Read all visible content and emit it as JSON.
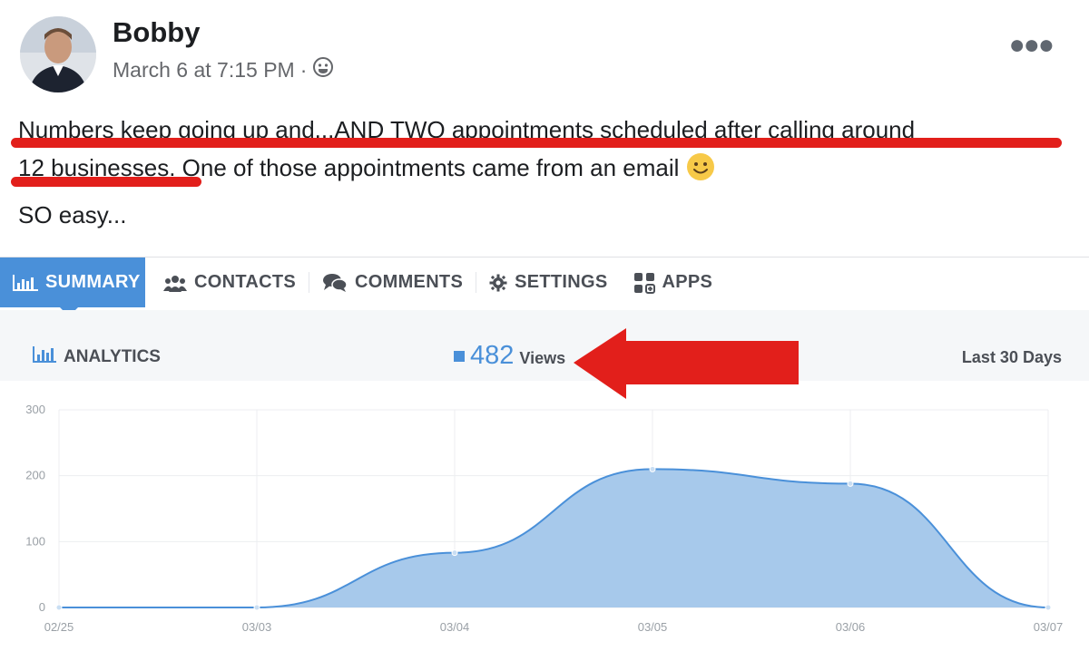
{
  "post": {
    "author": "Bobby",
    "timestamp": "March 6 at 7:15 PM",
    "separator": "·",
    "audience_icon": "friends-icon",
    "more_icon": "ellipsis-icon",
    "line1": "Numbers keep going up and...AND TWO appointments scheduled after calling around",
    "line2_start": "12 businesses.",
    "line2_end": " One of those appointments came from an email ",
    "line3": "SO easy..."
  },
  "tabs": [
    {
      "label": "SUMMARY",
      "icon": "bar-chart-icon",
      "active": true
    },
    {
      "label": "CONTACTS",
      "icon": "people-icon",
      "active": false
    },
    {
      "label": "COMMENTS",
      "icon": "comments-icon",
      "active": false
    },
    {
      "label": "SETTINGS",
      "icon": "gear-icon",
      "active": false
    },
    {
      "label": "APPS",
      "icon": "apps-icon",
      "active": false
    }
  ],
  "analytics": {
    "title": "ANALYTICS",
    "views_count": "482",
    "views_label": "Views",
    "range": "Last 30 Days"
  },
  "colors": {
    "accent": "#4a90d9",
    "area_fill": "#a7c9eb",
    "annotation_red": "#e21f1b"
  },
  "chart_data": {
    "type": "area",
    "x": [
      "02/25",
      "03/03",
      "03/04",
      "03/05",
      "03/06",
      "03/07"
    ],
    "series": [
      {
        "values": [
          0,
          0,
          83,
          210,
          188,
          0
        ]
      }
    ],
    "yticks": [
      "0",
      "100",
      "200",
      "300"
    ],
    "ylim": [
      0,
      300
    ],
    "grid": true
  }
}
